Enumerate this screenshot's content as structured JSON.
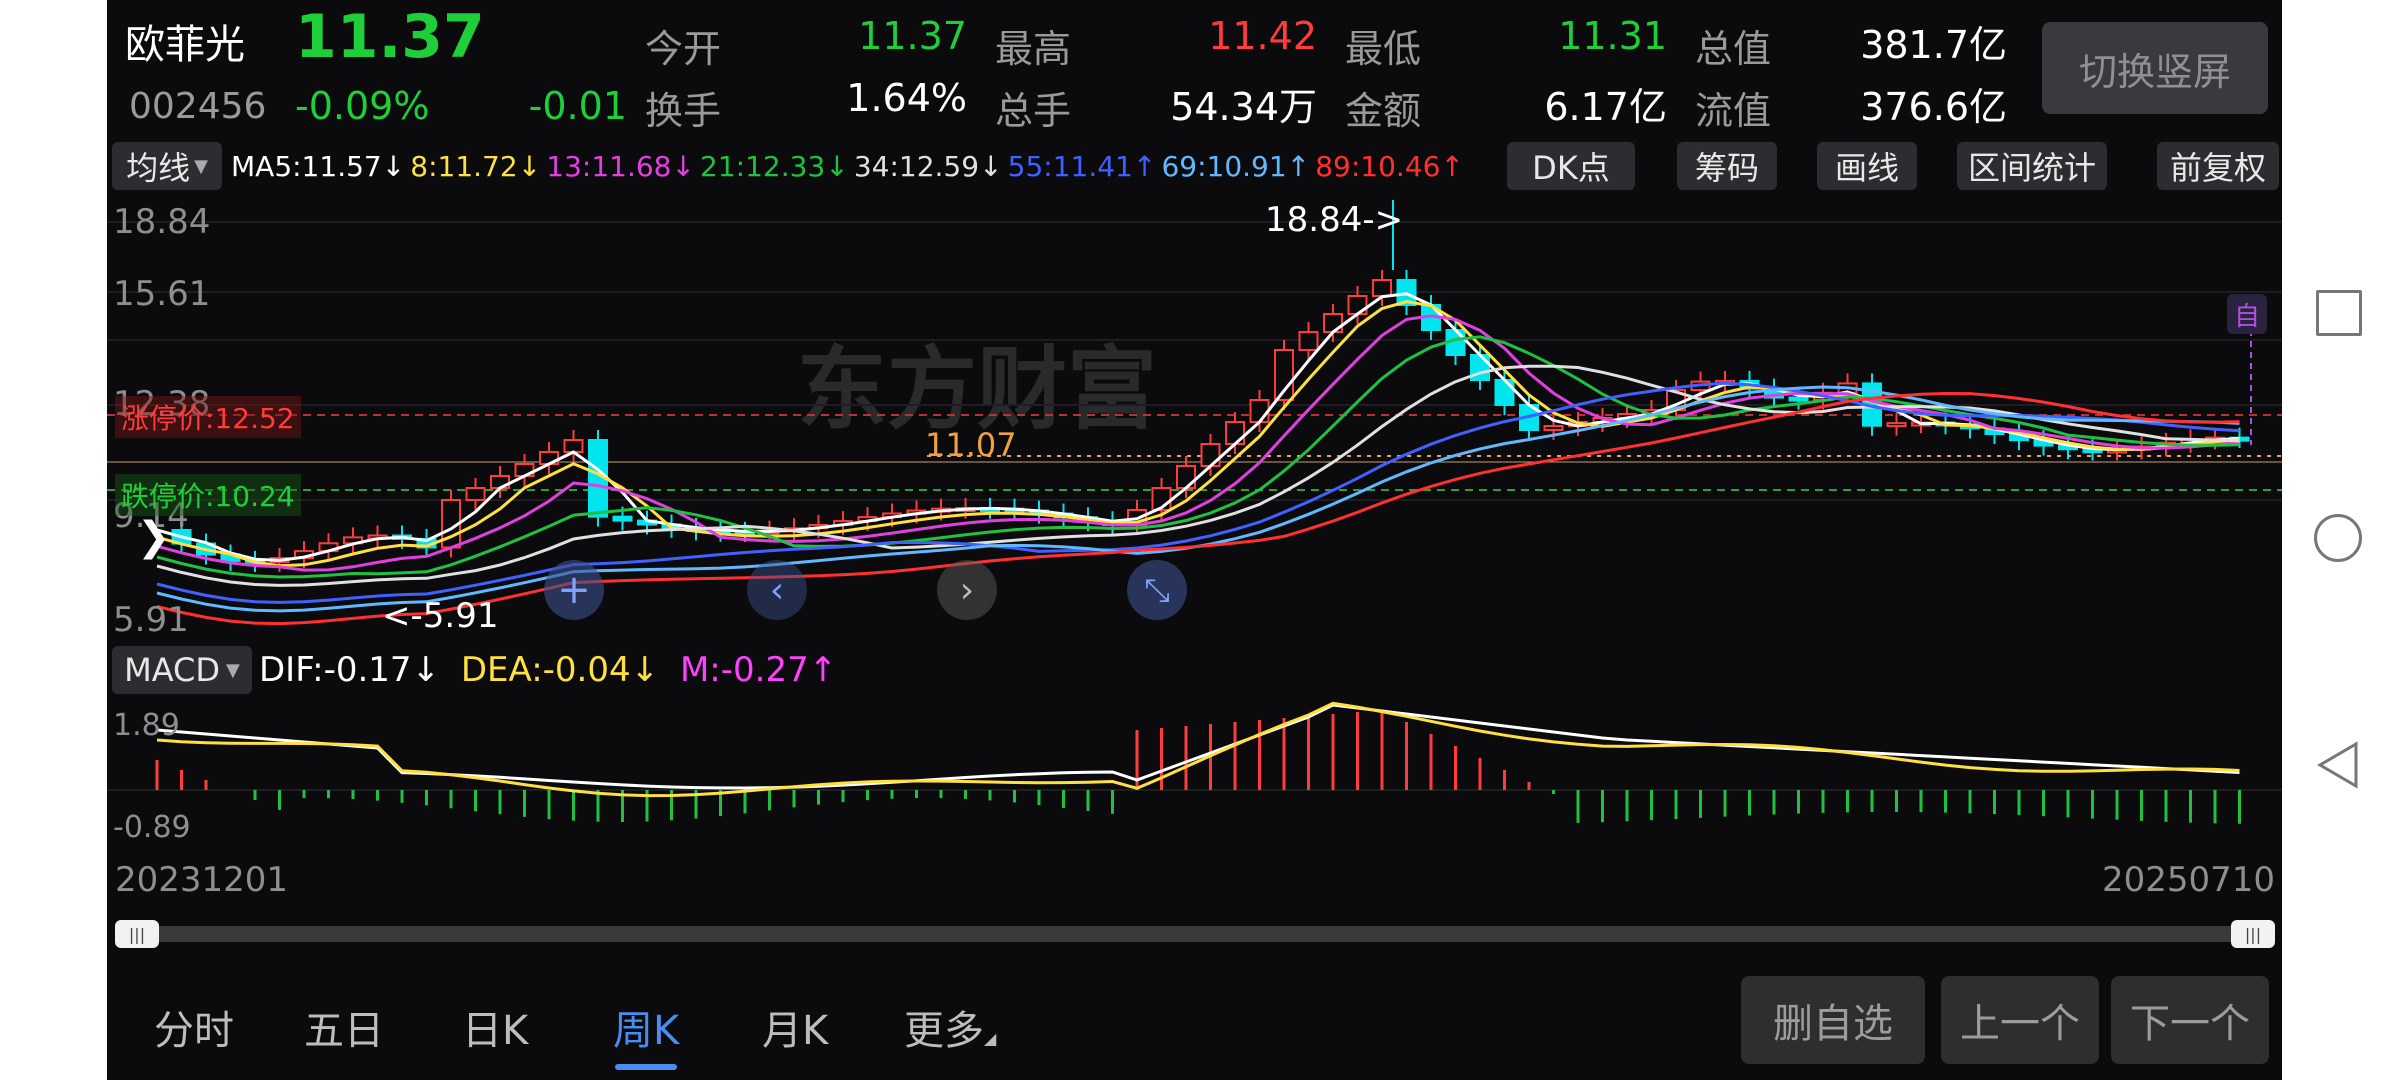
{
  "stock": {
    "name": "欧菲光",
    "code": "002456",
    "price": "11.37",
    "change_pct": "-0.09%",
    "change": "-0.01"
  },
  "stats": [
    {
      "label": "今开",
      "value": "11.37",
      "color": "#1fcf3a"
    },
    {
      "label": "最高",
      "value": "11.42",
      "color": "#ff3b3b"
    },
    {
      "label": "最低",
      "value": "11.31",
      "color": "#1fcf3a"
    },
    {
      "label": "总值",
      "value": "381.7亿",
      "color": "#ffffff"
    },
    {
      "label": "换手",
      "value": "1.64%",
      "color": "#ffffff"
    },
    {
      "label": "总手",
      "value": "54.34万",
      "color": "#ffffff"
    },
    {
      "label": "金额",
      "value": "6.17亿",
      "color": "#ffffff"
    },
    {
      "label": "流值",
      "value": "376.6亿",
      "color": "#ffffff"
    }
  ],
  "switch_button": "切换竖屏",
  "toolbar": {
    "indicator_select": "均线",
    "ma": [
      {
        "text": "MA5:11.57",
        "arrow": "↓",
        "color": "#ffffff"
      },
      {
        "text": "8:11.72",
        "arrow": "↓",
        "color": "#ffe040"
      },
      {
        "text": "13:11.68",
        "arrow": "↓",
        "color": "#e040e0"
      },
      {
        "text": "21:12.33",
        "arrow": "↓",
        "color": "#20c040"
      },
      {
        "text": "34:12.59",
        "arrow": "↓",
        "color": "#e0e0e0"
      },
      {
        "text": "55:11.41",
        "arrow": "↑",
        "color": "#4060ff"
      },
      {
        "text": "69:10.91",
        "arrow": "↑",
        "color": "#60b8ff"
      },
      {
        "text": "89:10.46",
        "arrow": "↑",
        "color": "#ff3030"
      }
    ],
    "dk_button": "DK点",
    "chip_button": "筹码",
    "draw_button": "画线",
    "interval_button": "区间统计",
    "adjust_button": "前复权"
  },
  "kchart": {
    "y_labels": [
      "18.84",
      "15.61",
      "12.38",
      "9.14",
      "5.91"
    ],
    "limit_up_label": "涨停价:12.52",
    "limit_down_label": "跌停价:10.24",
    "current_label": "11.07",
    "high_marker": "18.84->",
    "low_marker": "<-5.91",
    "watermark": "东方财富",
    "self_badge": "自"
  },
  "macd": {
    "select": "MACD",
    "dif": "DIF:-0.17",
    "dif_arrow": "↓",
    "dea": "DEA:-0.04",
    "dea_arrow": "↓",
    "m": "M:-0.27",
    "m_arrow": "↑",
    "y_top": "1.89",
    "y_bottom": "-0.89"
  },
  "dates": {
    "start": "20231201",
    "end": "20250710"
  },
  "tabs": [
    "分时",
    "五日",
    "日K",
    "周K",
    "月K",
    "更多"
  ],
  "active_tab": "周K",
  "bottom_buttons": [
    "删自选",
    "上一个",
    "下一个"
  ],
  "colors": {
    "up": "#ff3b3b",
    "down": "#00e5ee",
    "accent_tab": "#4a8cf0"
  }
}
